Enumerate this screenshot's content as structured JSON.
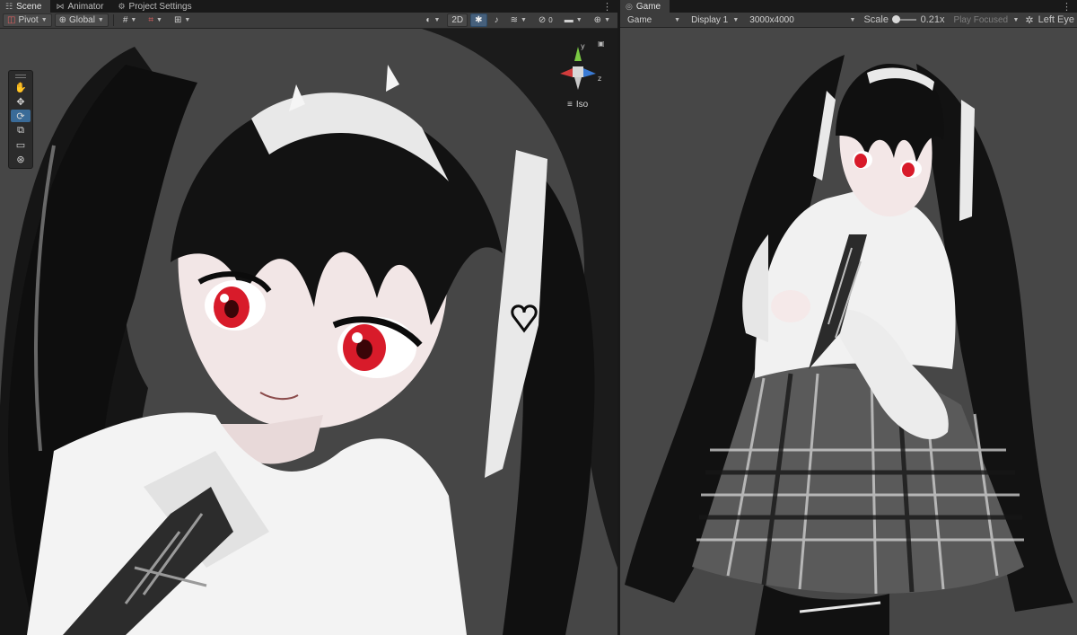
{
  "scene": {
    "tabs": [
      {
        "label": "Scene",
        "icon": "grid-icon"
      },
      {
        "label": "Animator",
        "icon": "animator-icon"
      },
      {
        "label": "Project Settings",
        "icon": "gear-icon"
      }
    ],
    "toolbar": {
      "pivot_label": "Pivot",
      "global_label": "Global",
      "mode_2d_label": "2D"
    },
    "tools": [
      "hand-tool",
      "move-tool",
      "rotate-tool",
      "scale-tool",
      "rect-tool",
      "transform-tool"
    ],
    "selected_tool": "rotate-tool",
    "gizmo": {
      "y_label": "y",
      "z_label": "z",
      "projection_label": "Iso"
    }
  },
  "game": {
    "tabs": [
      {
        "label": "Game",
        "icon": "gamepad-icon"
      }
    ],
    "toolbar": {
      "mode_select": "Game",
      "display_select": "Display 1",
      "resolution_select": "3000x4000",
      "scale_label": "Scale",
      "scale_value": "0.21x",
      "play_focused_label": "Play Focused",
      "eye_label": "Left Eye"
    }
  },
  "colors": {
    "selected_tool": "#3a6b98",
    "viewport_bg": "#464646",
    "gizmo_x": "#d23c3c",
    "gizmo_y": "#7ac943",
    "gizmo_z": "#3a7bd5"
  }
}
